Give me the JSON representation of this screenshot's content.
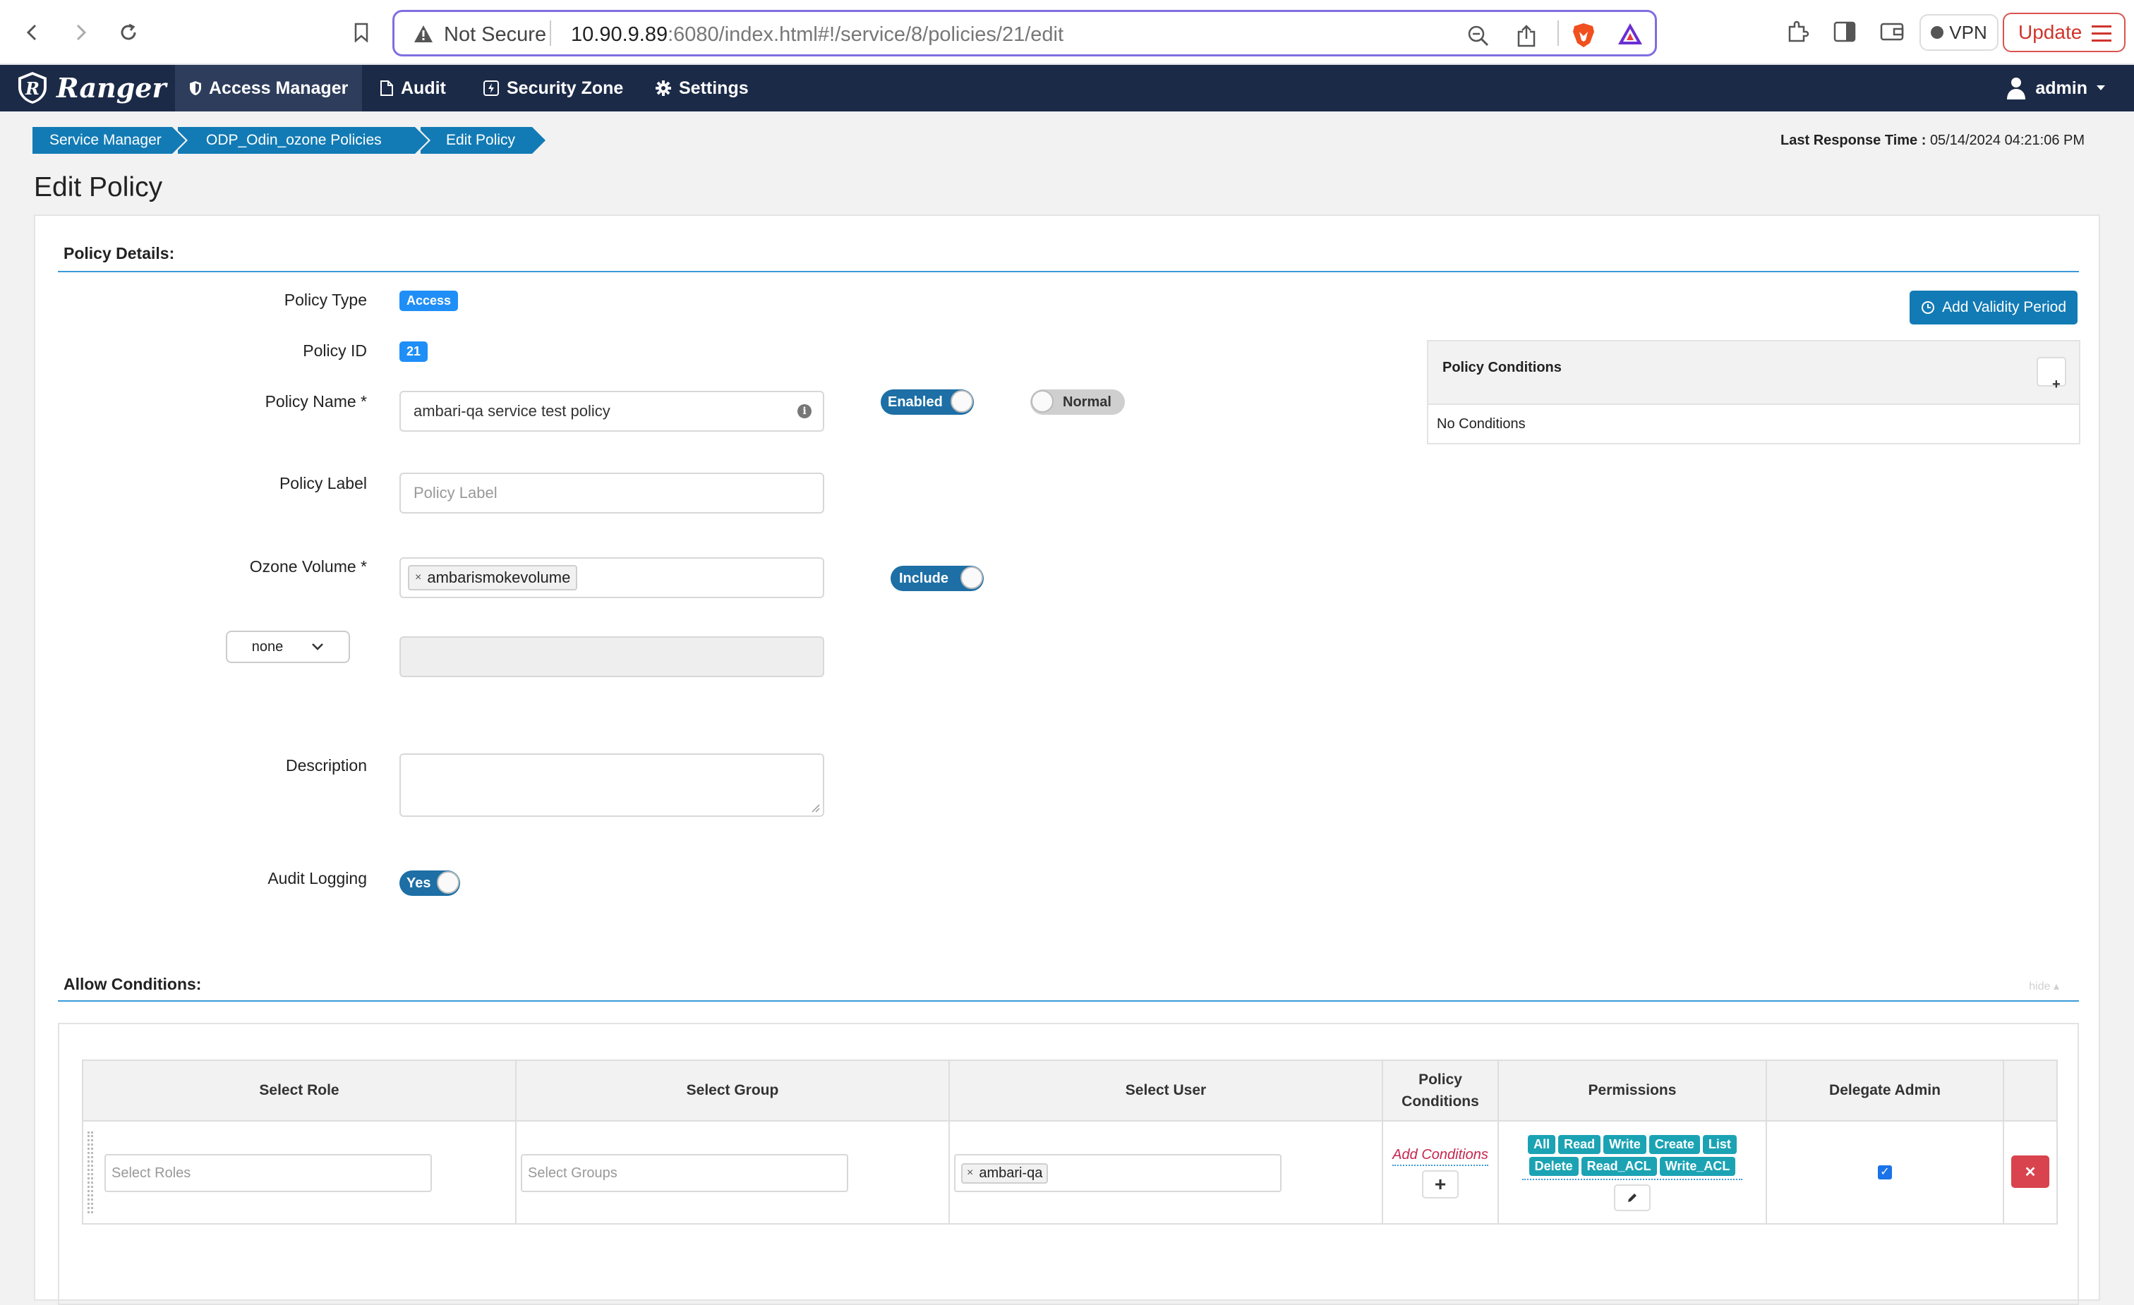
{
  "browser": {
    "security_label": "Not Secure",
    "url_host": "10.90.9.89",
    "url_rest": ":6080/index.html#!/service/8/policies/21/edit",
    "vpn_label": "VPN",
    "update_label": "Update"
  },
  "app": {
    "logo_text": "Ranger",
    "nav": {
      "access_manager": "Access Manager",
      "audit": "Audit",
      "security_zone": "Security Zone",
      "settings": "Settings"
    },
    "user": "admin"
  },
  "breadcrumb": [
    "Service Manager",
    "ODP_Odin_ozone Policies",
    "Edit Policy"
  ],
  "last_response": {
    "label": "Last Response Time :",
    "value": "05/14/2024 04:21:06 PM"
  },
  "page_title": "Edit Policy",
  "policy_details": {
    "title": "Policy Details:",
    "policy_type_label": "Policy Type",
    "policy_type": "Access",
    "policy_id_label": "Policy ID",
    "policy_id": "21",
    "policy_name_label": "Policy Name *",
    "policy_name": "ambari-qa service test policy",
    "enabled_toggle": "Enabled",
    "priority_toggle": "Normal",
    "policy_label_label": "Policy Label",
    "policy_label_placeholder": "Policy Label",
    "ozone_volume_label": "Ozone Volume *",
    "ozone_volume_tag": "ambarismokevolume",
    "include_toggle": "Include",
    "resource_select": "none",
    "description_label": "Description",
    "audit_logging_label": "Audit Logging",
    "audit_logging": "Yes",
    "add_validity_period": "Add Validity Period",
    "policy_conditions_title": "Policy Conditions",
    "policy_conditions_body": "No Conditions"
  },
  "allow_conditions": {
    "title": "Allow Conditions:",
    "hide_link": "hide",
    "columns": [
      "Select Role",
      "Select Group",
      "Select User",
      "Policy Conditions",
      "Permissions",
      "Delegate Admin"
    ],
    "row": {
      "roles_placeholder": "Select Roles",
      "groups_placeholder": "Select Groups",
      "user_tag": "ambari-qa",
      "add_conditions": "Add Conditions",
      "permissions_line1": [
        "All",
        "Read",
        "Write",
        "Create",
        "List"
      ],
      "permissions_line2": [
        "Delete",
        "Read_ACL",
        "Write_ACL"
      ],
      "delegate_admin": true
    }
  },
  "colors": {
    "navbar": "#1b2a47",
    "accent": "#127bb5",
    "permission_tag": "#1ba3b4",
    "delete": "#d9434e"
  },
  "icons": [
    "back-icon",
    "forward-icon",
    "reload-icon",
    "bookmark-icon",
    "warning-icon",
    "zoom-icon",
    "share-icon",
    "brave-icon",
    "aurora-icon",
    "extensions-icon",
    "sidebar-icon",
    "wallet-icon",
    "shield-icon",
    "file-icon",
    "zone-icon",
    "gear-icon",
    "user-icon",
    "caret-down-icon",
    "info-icon",
    "clock-icon",
    "plus-icon",
    "chevron-down-icon",
    "pencil-icon",
    "close-icon",
    "checkbox-icon"
  ]
}
